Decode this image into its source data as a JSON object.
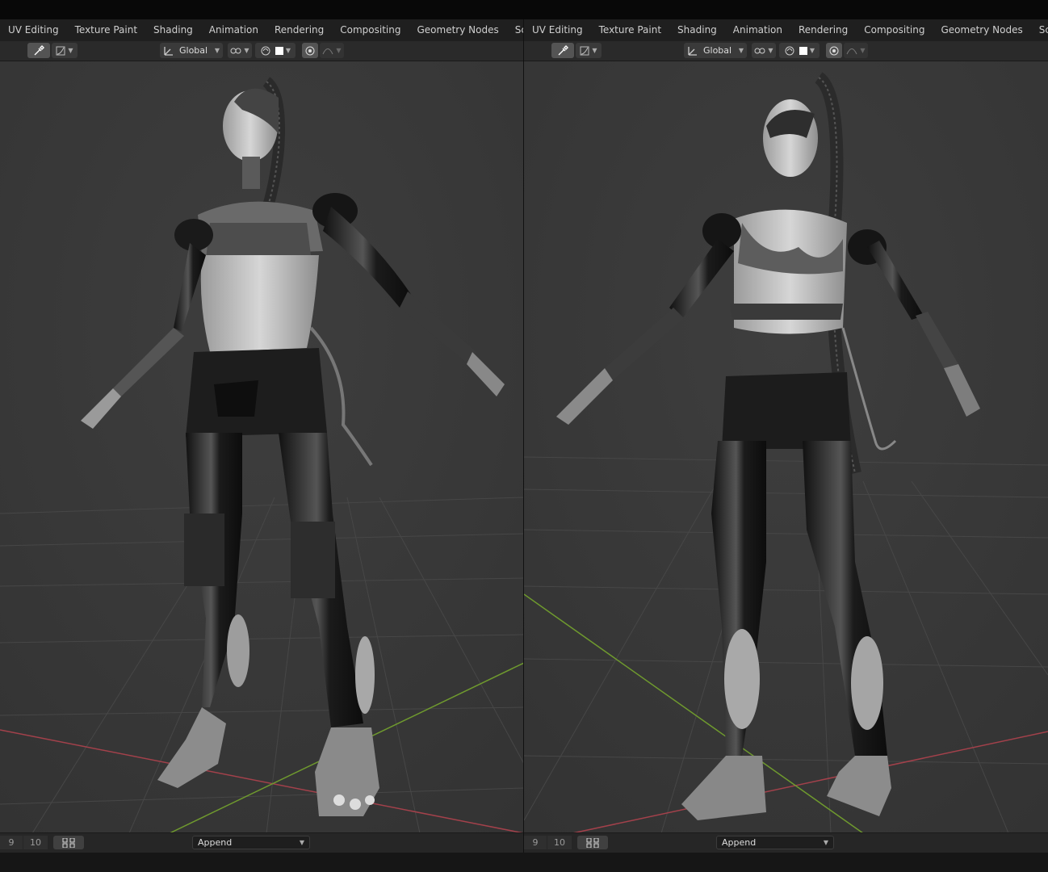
{
  "workspace_tabs": [
    "UV Editing",
    "Texture Paint",
    "Shading",
    "Animation",
    "Rendering",
    "Compositing",
    "Geometry Nodes",
    "Scripting"
  ],
  "add_workspace_symbol": "+",
  "header": {
    "transform_orientation": "Global"
  },
  "footer": {
    "numbers": [
      "9",
      "10"
    ],
    "append_label": "Append"
  },
  "colors": {
    "viewport_bg": "#393939",
    "axis_x": "#a3414b",
    "axis_y": "#6f9a2e",
    "grid": "#4a4a4a"
  },
  "icons": [
    "eyedropper-icon",
    "curve-icon",
    "transform-orientation-icon",
    "snap-icon",
    "proportional-edit-icon",
    "color-swatch-icon",
    "falloff-icon",
    "grid-view-icon",
    "chevron-down-icon"
  ]
}
